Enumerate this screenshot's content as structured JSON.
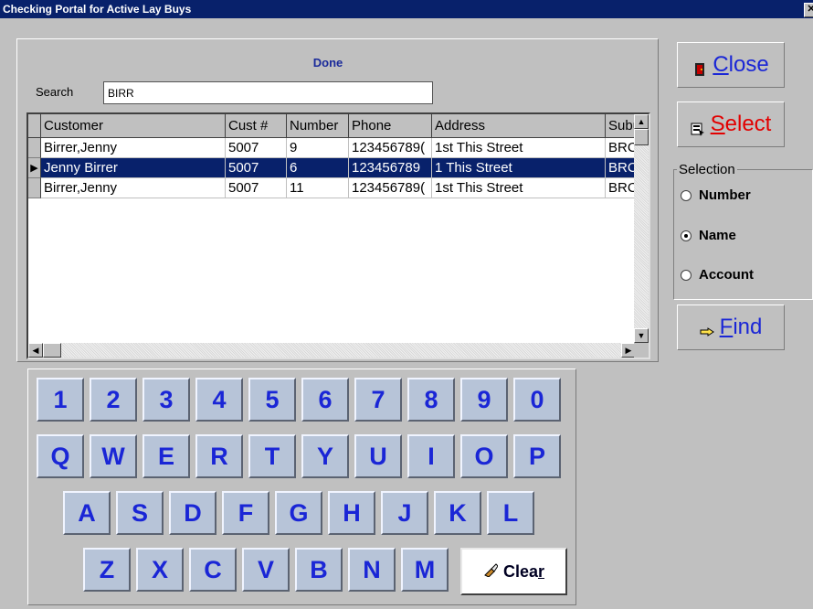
{
  "window": {
    "title": "Checking Portal for Active Lay Buys",
    "close_glyph": "✕"
  },
  "status": {
    "done_label": "Done"
  },
  "search": {
    "label": "Search",
    "value": "BIRR"
  },
  "table": {
    "columns": [
      "Customer",
      "Cust #",
      "Number",
      "Phone",
      "Address",
      "Subu"
    ],
    "rows": [
      [
        "Birrer,Jenny",
        "5007",
        "9",
        "123456789(",
        "1st This Street",
        "BRC"
      ],
      [
        "Jenny Birrer",
        "5007",
        "6",
        "123456789",
        "1 This Street",
        "BRC"
      ],
      [
        "Birrer,Jenny",
        "5007",
        "11",
        "123456789(",
        "1st This Street",
        "BRC"
      ]
    ],
    "selected_row": 1
  },
  "buttons": {
    "close": {
      "label_underlined": "C",
      "label_rest": "lose"
    },
    "select": {
      "label_underlined": "S",
      "label_rest": "elect"
    },
    "find": {
      "label_underlined": "F",
      "label_rest": "ind"
    }
  },
  "selection": {
    "legend": "Selection",
    "options": [
      "Number",
      "Name",
      "Account"
    ],
    "checked": "Name"
  },
  "keypad": {
    "row1": [
      "1",
      "2",
      "3",
      "4",
      "5",
      "6",
      "7",
      "8",
      "9",
      "0"
    ],
    "row2": [
      "Q",
      "W",
      "E",
      "R",
      "T",
      "Y",
      "U",
      "I",
      "O",
      "P"
    ],
    "row3": [
      "A",
      "S",
      "D",
      "F",
      "G",
      "H",
      "J",
      "K",
      "L"
    ],
    "row4": [
      "Z",
      "X",
      "C",
      "V",
      "B",
      "N",
      "M"
    ],
    "clear_label_main": "Clea",
    "clear_label_underlined": "r"
  },
  "colors": {
    "selection_bg": "#08216b",
    "accent_blue": "#1a26d6",
    "accent_red": "#e20000"
  }
}
